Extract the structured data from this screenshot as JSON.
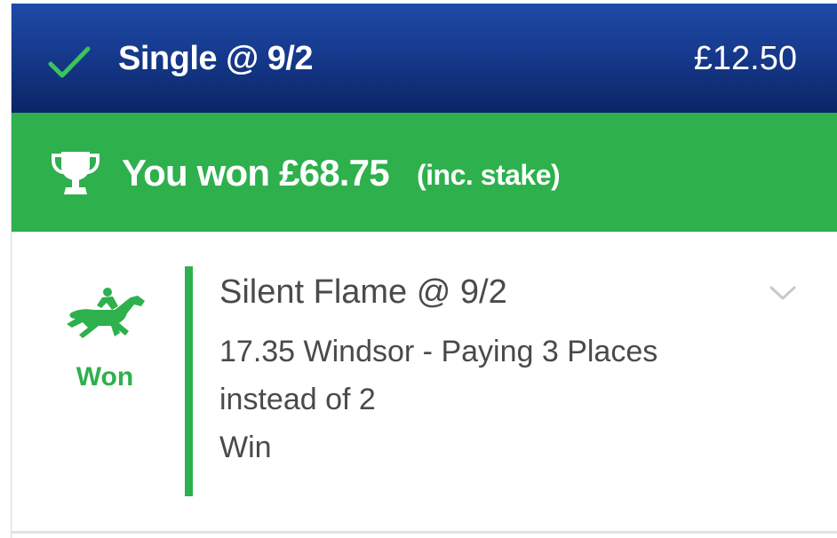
{
  "header": {
    "status_icon": "check-icon",
    "bet_type": "Single @ 9/2",
    "stake": "£12.50"
  },
  "win_banner": {
    "icon": "trophy-icon",
    "won_text": "You won £68.75",
    "inc_stake": "(inc. stake)"
  },
  "selection": {
    "icon": "horse-racing-icon",
    "result": "Won",
    "runner": "Silent Flame @ 9/2",
    "race": "17.35 Windsor - Paying 3 Places instead of 2",
    "market": "Win",
    "expand_icon": "chevron-down-icon"
  },
  "colors": {
    "header_blue": "#163a8e",
    "win_green": "#2eb04d",
    "text_grey": "#4a4a4a",
    "chevron_grey": "#c8c8c8"
  }
}
